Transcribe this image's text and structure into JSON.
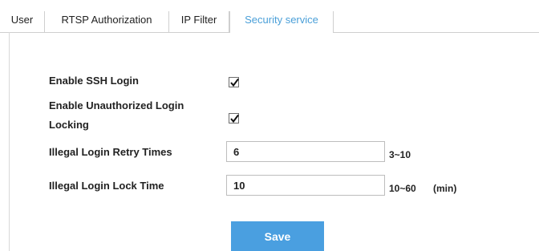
{
  "tabs": [
    {
      "label": "User"
    },
    {
      "label": "RTSP Authorization"
    },
    {
      "label": "IP Filter"
    },
    {
      "label": "Security service"
    }
  ],
  "form": {
    "ssh_label": "Enable SSH Login",
    "ssh_checked": true,
    "lock_label_line1": "Enable Unauthorized Login",
    "lock_label_line2": "Locking",
    "lock_checked": true,
    "retry_label": "Illegal Login Retry Times",
    "retry_value": "6",
    "retry_range": "3~10",
    "lock_time_label": "Illegal Login Lock Time",
    "lock_time_value": "10",
    "lock_time_range": "10~60",
    "lock_time_unit": "(min)"
  },
  "save_label": "Save",
  "colors": {
    "accent": "#4a9fe0",
    "active_tab": "#4a9fd8"
  }
}
